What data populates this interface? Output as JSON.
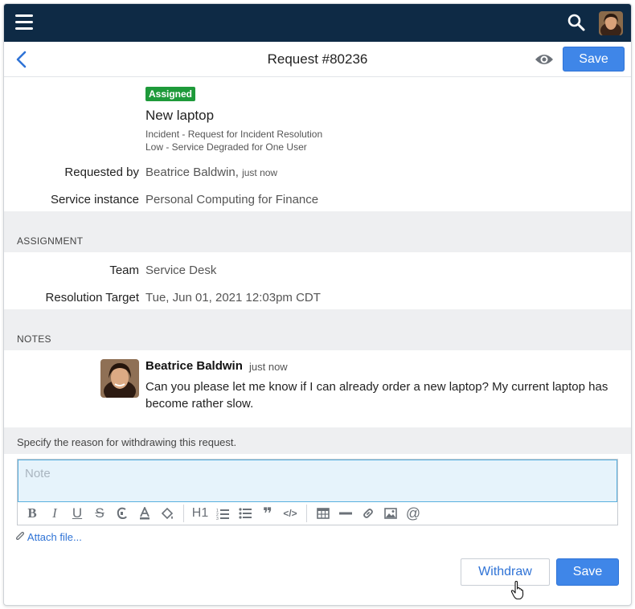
{
  "topbar": {
    "menu_icon": "hamburger-menu-icon",
    "search_icon": "search-icon",
    "avatar": "user-avatar"
  },
  "header": {
    "title": "Request #80236",
    "save_label": "Save",
    "back_icon": "chevron-left-icon",
    "watch_icon": "eye-icon"
  },
  "request": {
    "status_badge": "Assigned",
    "subject": "New laptop",
    "category_line": "Incident - Request for Incident Resolution",
    "impact_line": "Low - Service Degraded for One User",
    "requested_by_label": "Requested by",
    "requested_by_value": "Beatrice Baldwin,",
    "requested_by_time": "just now",
    "service_instance_label": "Service instance",
    "service_instance_value": "Personal Computing for Finance"
  },
  "assignment": {
    "section_title": "ASSIGNMENT",
    "team_label": "Team",
    "team_value": "Service Desk",
    "resolution_label": "Resolution Target",
    "resolution_value": "Tue, Jun 01, 2021 12:03pm CDT"
  },
  "notes": {
    "section_title": "NOTES",
    "items": [
      {
        "author": "Beatrice Baldwin",
        "time": "just now",
        "text": "Can you please let me know if I can already order a new laptop? My current laptop has become rather slow."
      }
    ]
  },
  "withdraw": {
    "instruction": "Specify the reason for withdrawing this request.",
    "note_placeholder": "Note",
    "toolbar": [
      "bold-icon",
      "italic-icon",
      "underline-icon",
      "strikethrough-icon",
      "clear-format-icon",
      "text-color-icon",
      "highlight-icon",
      "heading-icon",
      "ordered-list-icon",
      "bullet-list-icon",
      "quote-icon",
      "code-icon",
      "table-icon",
      "horizontal-rule-icon",
      "link-icon",
      "image-icon",
      "mention-icon"
    ],
    "toolbar_glyphs": {
      "bold": "B",
      "italic": "I",
      "underline": "U",
      "strike": "S",
      "heading": "H1",
      "quote": "❞",
      "code": "</>",
      "mention": "@"
    },
    "attach_label": "Attach file...",
    "withdraw_label": "Withdraw",
    "save_label": "Save"
  },
  "colors": {
    "nav_bg": "#0e2a45",
    "primary": "#3f86e8",
    "success": "#1e9a3a",
    "section_bg": "#eeeff1"
  }
}
